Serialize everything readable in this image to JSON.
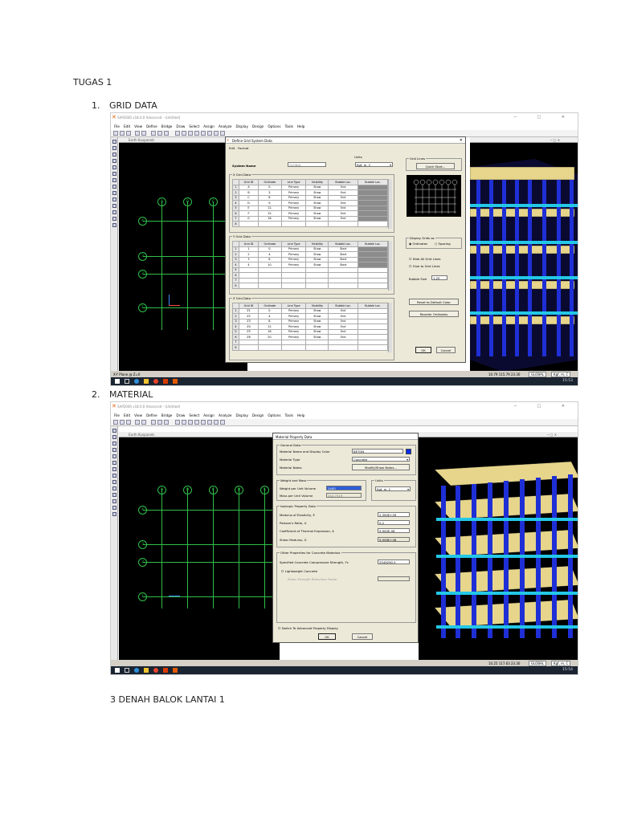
{
  "doc": {
    "heading": "TUGAS 1",
    "items": [
      {
        "number": "1.",
        "label": "GRID DATA"
      },
      {
        "number": "2.",
        "label": "MATERIAL"
      }
    ],
    "item3": "3 DENAH BALOK LANTAI 1"
  },
  "app": {
    "title": "SAP2000 v18.0.0 Advanced  - (Untitled)",
    "menu": [
      "File",
      "Edit",
      "View",
      "Define",
      "Bridge",
      "Draw",
      "Select",
      "Assign",
      "Analyze",
      "Display",
      "Design",
      "Options",
      "Tools",
      "Help"
    ],
    "window_controls": "─ □ ✕",
    "viewport_title": "Earth Kuspanels",
    "status1": "X-Y Plane @ Z=0",
    "status_units": "Kgf, m, C",
    "status_global": "GLOBAL",
    "coords1": "10.79 115.79 23.30",
    "coords2": "10.25 117.63 23.30",
    "clock1": "15:53",
    "clock2": "15:54"
  },
  "bubbles1": [
    "A",
    "B",
    "C",
    "4",
    "3",
    "2",
    "1"
  ],
  "bubbles2": [
    "A",
    "B",
    "C",
    "D",
    "E",
    "4",
    "3",
    "2",
    "1"
  ],
  "grid_dialog": {
    "title": "Define Grid System Data",
    "menu": [
      "Edit",
      "Format"
    ],
    "system_name_label": "System Name",
    "system_name_value": "GLOBAL",
    "units_label": "Units",
    "units_value": "Kgf, m, C",
    "grid_lines_label": "Grid Lines",
    "quick_start": "Quick Start...",
    "x_label": "X Grid Data",
    "y_label": "Y Grid Data",
    "z_label": "Z Grid Data",
    "headers": [
      "Grid ID",
      "Ordinate",
      "Line Type",
      "Visibility",
      "Bubble Loc.",
      "Bubble Loc."
    ],
    "x_rows": [
      [
        "1",
        "A",
        "0.",
        "Primary",
        "Show",
        "End"
      ],
      [
        "2",
        "B",
        "3.",
        "Primary",
        "Show",
        "End"
      ],
      [
        "3",
        "C",
        "6.",
        "Primary",
        "Show",
        "End"
      ],
      [
        "4",
        "D",
        "9.",
        "Primary",
        "Show",
        "End"
      ],
      [
        "5",
        "E",
        "12.",
        "Primary",
        "Show",
        "End"
      ],
      [
        "6",
        "F",
        "15.",
        "Primary",
        "Show",
        "End"
      ],
      [
        "7",
        "G",
        "18.",
        "Primary",
        "Show",
        "End"
      ],
      [
        "8",
        "",
        "",
        "",
        "",
        ""
      ]
    ],
    "y_rows": [
      [
        "1",
        "1",
        "0.",
        "Primary",
        "Show",
        "Start"
      ],
      [
        "2",
        "2",
        "4.",
        "Primary",
        "Show",
        "Start"
      ],
      [
        "3",
        "3",
        "6.",
        "Primary",
        "Show",
        "Start"
      ],
      [
        "4",
        "4",
        "10.",
        "Primary",
        "Show",
        "Start"
      ],
      [
        "5",
        "",
        "",
        "",
        "",
        ""
      ],
      [
        "6",
        "",
        "",
        "",
        "",
        ""
      ],
      [
        "7",
        "",
        "",
        "",
        "",
        ""
      ],
      [
        "8",
        "",
        "",
        "",
        "",
        ""
      ]
    ],
    "z_rows": [
      [
        "1",
        "Z1",
        "0.",
        "Primary",
        "Show",
        "End"
      ],
      [
        "2",
        "Z2",
        "4.",
        "Primary",
        "Show",
        "End"
      ],
      [
        "3",
        "Z3",
        "8.",
        "Primary",
        "Show",
        "End"
      ],
      [
        "4",
        "Z4",
        "12.",
        "Primary",
        "Show",
        "End"
      ],
      [
        "5",
        "Z5",
        "16.",
        "Primary",
        "Show",
        "End"
      ],
      [
        "6",
        "Z6",
        "20.",
        "Primary",
        "Show",
        "End"
      ],
      [
        "7",
        "",
        "",
        "",
        "",
        ""
      ],
      [
        "8",
        "",
        "",
        "",
        "",
        ""
      ]
    ],
    "display_grids_as": "Display Grids as",
    "ordinates": "Ordinates",
    "spacing": "Spacing",
    "hide_all": "Hide All Grid Lines",
    "glue": "Glue to Grid Lines",
    "bubble_size_label": "Bubble Size",
    "bubble_size_value": "1.25",
    "reset_color": "Reset to Default Color",
    "reorder": "Reorder Ordinates",
    "ok": "OK",
    "cancel": "Cancel"
  },
  "material_dialog": {
    "title": "Material Property Data",
    "general": "General Data",
    "name_label": "Material Name and Display Color",
    "name_value": "BETON",
    "type_label": "Material Type",
    "type_value": "Concrete",
    "notes_label": "Material Notes",
    "notes_btn": "Modify/Show Notes...",
    "weight_group": "Weight and Mass",
    "units_group": "Units",
    "weight_label": "Weight per Unit Volume",
    "weight_value": "2400",
    "mass_label": "Mass per Unit Volume",
    "mass_value": "244.7319",
    "units_value": "Kgf, m, C",
    "isotropic": "Isotropic Property Data",
    "e_label": "Modulus of Elasticity,  E",
    "e_value": "2.390E+09",
    "u_label": "Poisson's Ratio,  U",
    "u_value": "0.2",
    "a_label": "Coefficient of Thermal Expansion,  A",
    "a_value": "9.900E-06",
    "g_label": "Shear Modulus,  G",
    "g_value": "9.958E+08",
    "other": "Other Properties for Concrete Materials",
    "fc_label": "Specified Concrete Compressive Strength, f'c",
    "fc_value": "2549290.5",
    "lightweight": "Lightweight Concrete",
    "shear_factor": "Shear Strength Reduction Factor",
    "advanced": "Switch To Advanced Property Display",
    "ok": "OK",
    "cancel": "Cancel"
  }
}
